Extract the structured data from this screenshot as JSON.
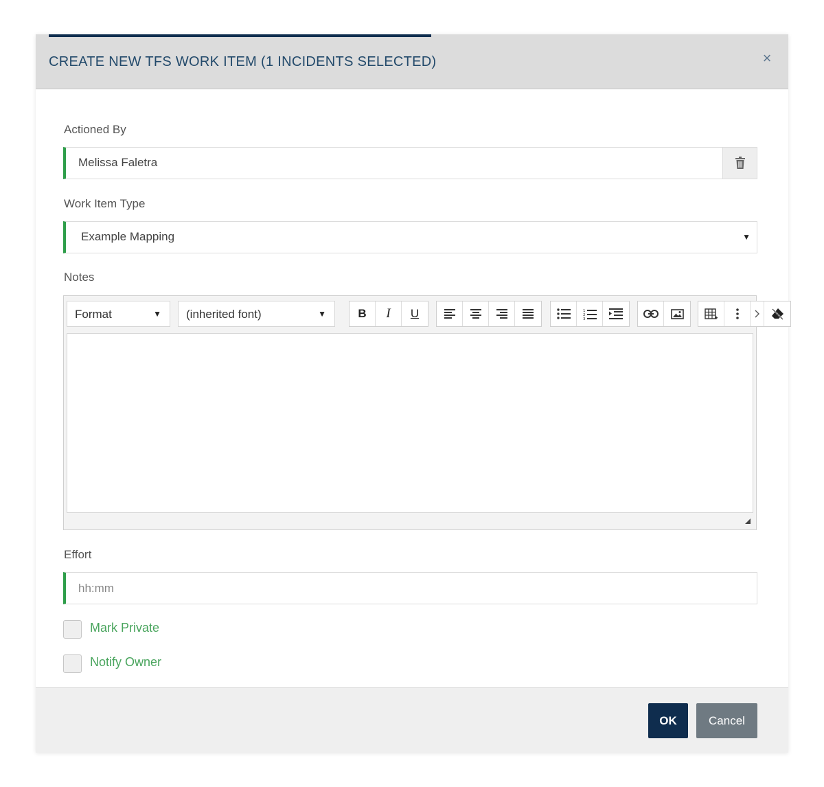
{
  "dialog": {
    "title": "CREATE NEW TFS WORK ITEM (1 INCIDENTS SELECTED)",
    "close_label": "×"
  },
  "actioned_by": {
    "label": "Actioned By",
    "value": "Melissa Faletra",
    "clear_icon": "trash-icon"
  },
  "work_item_type": {
    "label": "Work Item Type",
    "value": "Example Mapping"
  },
  "notes": {
    "label": "Notes",
    "format_dropdown": "Format",
    "font_dropdown": "(inherited font)",
    "bold": "B",
    "italic": "I",
    "underline": "U"
  },
  "effort": {
    "label": "Effort",
    "placeholder": "hh:mm"
  },
  "options": {
    "mark_private": "Mark Private",
    "notify_owner": "Notify Owner"
  },
  "footer": {
    "ok_label": "OK",
    "cancel_label": "Cancel"
  },
  "colors": {
    "accent_navy": "#0f2d4e",
    "field_green": "#2e9e4a",
    "cancel_gray": "#6f7a82"
  }
}
